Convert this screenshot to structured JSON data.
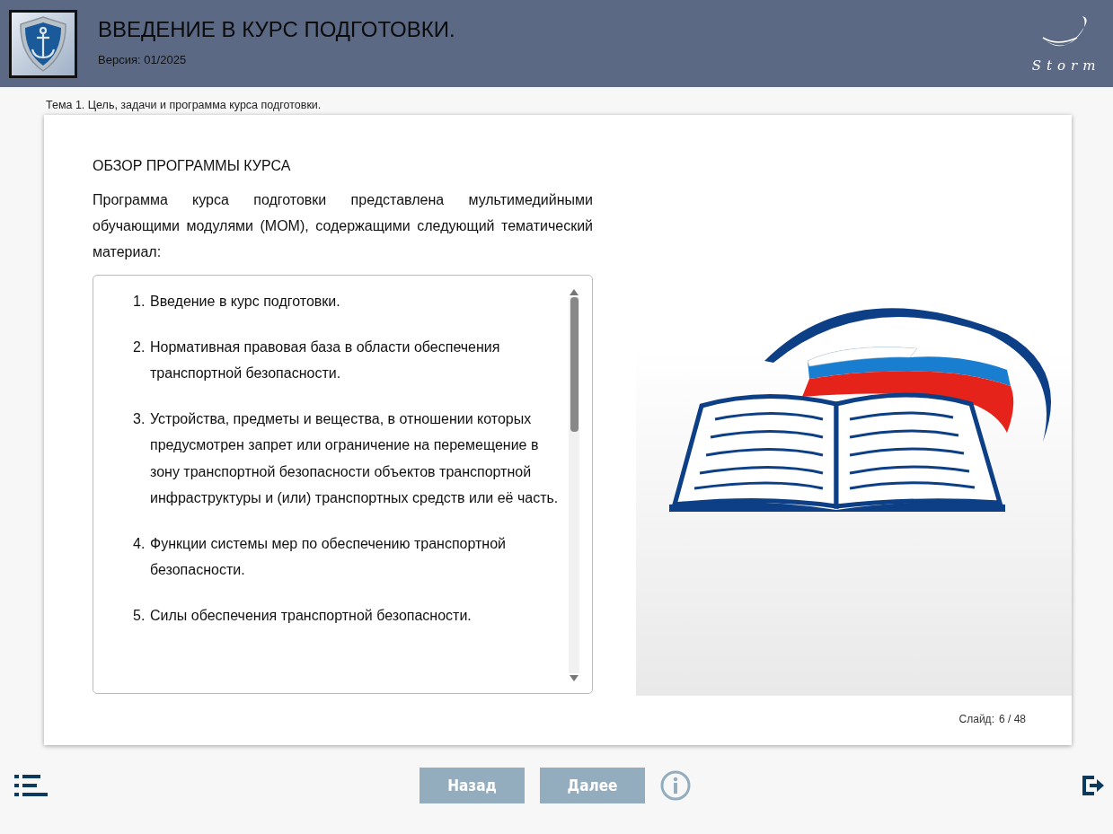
{
  "header": {
    "title": "ВВЕДЕНИЕ В КУРС ПОДГОТОВКИ.",
    "version": "Версия: 01/2025",
    "brand": "Storm"
  },
  "topic": "Тема 1. Цель, задачи и программа курса подготовки.",
  "slide": {
    "heading": "ОБЗОР ПРОГРАММЫ КУРСА",
    "intro": "Программа курса подготовки представлена мультимедийными обучающими модулями (МОМ), содержащими следующий тематический материал:",
    "items": [
      {
        "number": "1.",
        "text": "Введение в курс подготовки."
      },
      {
        "number": "2.",
        "text": "Нормативная правовая база в области обеспечения транспортной безопасности."
      },
      {
        "number": "3.",
        "text": "Устройства, предметы и вещества, в отношении которых предусмотрен запрет или ограничение на перемещение в зону транспортной безопасности объектов транспортной инфраструктуры и (или) транспортных средств или её часть."
      },
      {
        "number": "4.",
        "text": "Функции системы мер по обеспечению транспортной безопасности."
      },
      {
        "number": "5.",
        "text": "Силы обеспечения транспортной безопасности."
      }
    ],
    "counter_label": "Слайд:",
    "counter_value": "6 / 48"
  },
  "nav": {
    "back": "Назад",
    "next": "Далее"
  }
}
